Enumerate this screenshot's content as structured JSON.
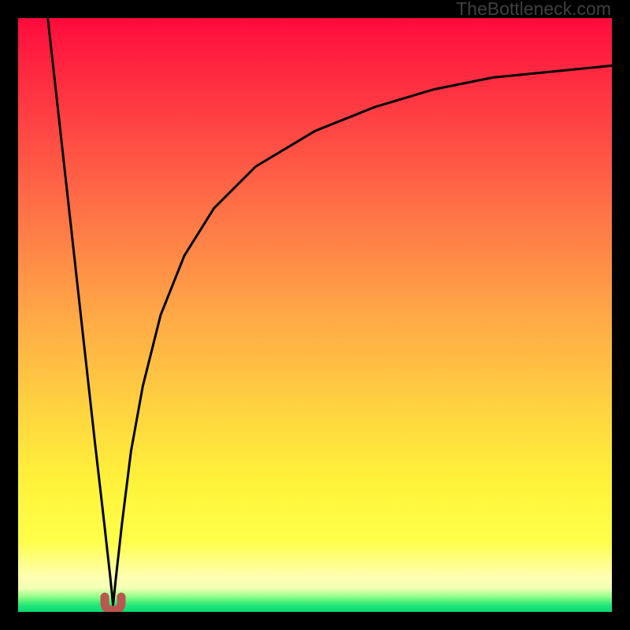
{
  "watermark": {
    "text": "TheBottleneck.com"
  },
  "colors": {
    "frame": "#000000",
    "curve": "#000000",
    "marker": "#b9574e",
    "gradient_top": "#ff0a3c",
    "gradient_bottom": "#0bd873"
  },
  "chart_data": {
    "type": "line",
    "title": "",
    "xlabel": "",
    "ylabel": "",
    "x_range": [
      0,
      100
    ],
    "y_range": [
      0,
      100
    ],
    "grid": false,
    "legend": false,
    "notes": "V-shaped bottleneck curve over a vertical heat gradient. The curve falls steeply from x≈5,y=100 to a minimum near x≈16,y≈1, then rises with decreasing slope toward the upper right, approaching y≈92 at x=100. A small rounded marker sits at the minimum.",
    "series": [
      {
        "name": "bottleneck-curve",
        "x": [
          5,
          7,
          9,
          11,
          13,
          14.5,
          15.5,
          16,
          16.5,
          17.5,
          19,
          21,
          24,
          28,
          33,
          40,
          50,
          60,
          70,
          80,
          90,
          100
        ],
        "y": [
          100,
          82,
          64,
          46,
          28,
          15,
          6,
          1.2,
          6,
          15,
          27,
          38,
          50,
          60,
          68,
          75,
          81,
          85,
          88,
          90,
          91,
          92
        ]
      }
    ],
    "marker": {
      "x": 16,
      "y": 1.2,
      "shape": "u",
      "color": "#b9574e"
    }
  }
}
